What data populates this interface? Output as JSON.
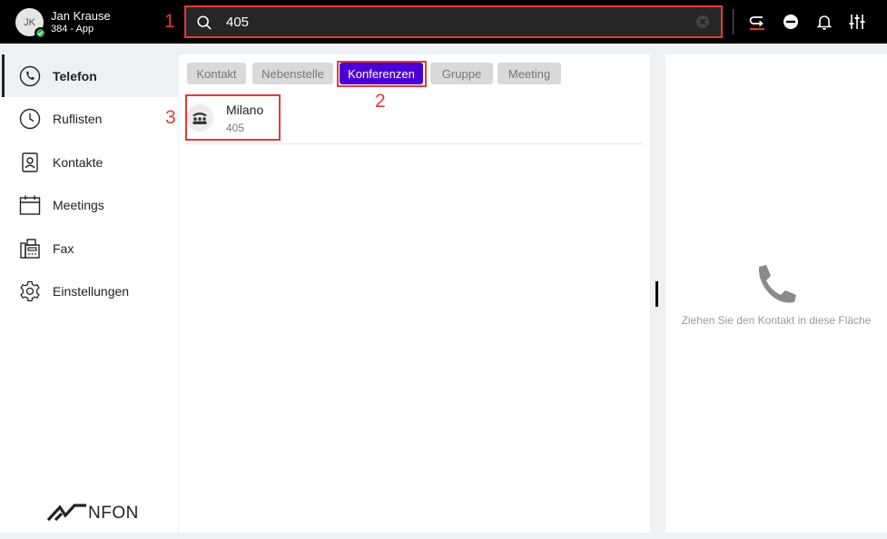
{
  "user": {
    "initials": "JK",
    "name": "Jan Krause",
    "extension": "384 - App"
  },
  "search": {
    "value": "405",
    "placeholder": ""
  },
  "annotations": [
    "1",
    "2",
    "3"
  ],
  "nav": {
    "items": [
      {
        "label": "Telefon",
        "icon": "phone-icon",
        "active": true
      },
      {
        "label": "Ruflisten",
        "icon": "clock-icon"
      },
      {
        "label": "Kontakte",
        "icon": "contact-card-icon"
      },
      {
        "label": "Meetings",
        "icon": "calendar-icon"
      },
      {
        "label": "Fax",
        "icon": "fax-icon"
      },
      {
        "label": "Einstellungen",
        "icon": "gear-icon"
      }
    ]
  },
  "brand": {
    "logo_text": "NFON"
  },
  "filters": [
    {
      "label": "Kontakt"
    },
    {
      "label": "Nebenstelle"
    },
    {
      "label": "Konferenzen",
      "active": true
    },
    {
      "label": "Gruppe"
    },
    {
      "label": "Meeting"
    }
  ],
  "results": [
    {
      "name": "Milano",
      "number": "405",
      "icon": "conference-icon"
    }
  ],
  "dropzone": {
    "text": "Ziehen Sie den Kontakt in diese Fläche"
  },
  "colors": {
    "accent": "#4a00d4",
    "annotation": "#e53935",
    "topbar": "#000000"
  }
}
